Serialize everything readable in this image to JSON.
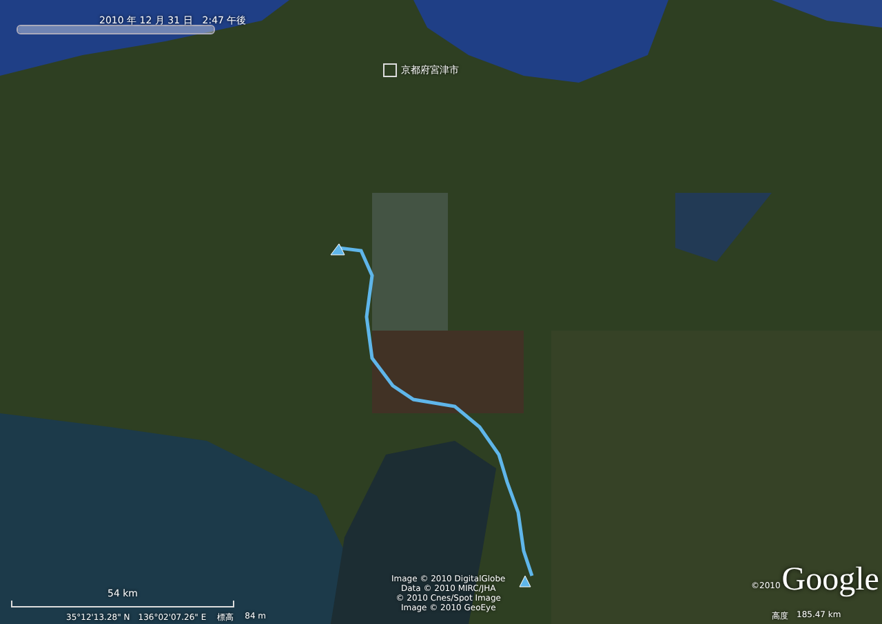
{
  "time_slider": {
    "label": "2010 年 12 月 31 日　2:47 午後",
    "level": 1
  },
  "place_label": "京都府宮津市",
  "scale_bar": {
    "label": "54 km"
  },
  "attribution": [
    "Image © 2010 DigitalGlobe",
    "Data © 2010 MIRC/JHA",
    "© 2010 Cnes/Spot Image",
    "Image © 2010 GeoEye"
  ],
  "status_bar": {
    "coordinates": "35°12'13.28\" N　136°02'07.26\" E",
    "elevation_label": "標高",
    "elevation": "84 m",
    "altitude_label": "高度",
    "altitude": "185.47 km"
  },
  "logo": {
    "copyright": "©2010",
    "name": "Google"
  }
}
